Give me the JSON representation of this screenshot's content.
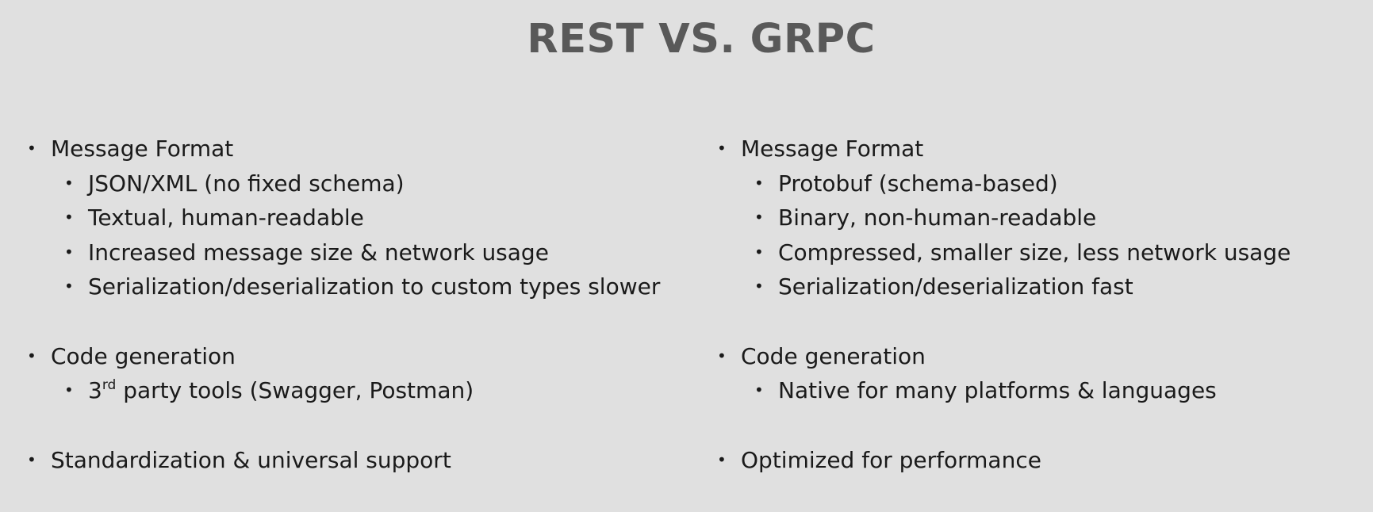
{
  "title": "REST VS. GRPC",
  "bullet_glyph": "•",
  "left": {
    "message_format": {
      "heading": "Message Format",
      "items": [
        "JSON/XML (no fixed schema)",
        "Textual, human-readable",
        "Increased message size & network usage",
        "Serialization/deserialization to custom types slower"
      ]
    },
    "code_generation": {
      "heading": "Code generation",
      "item_prefix": "3",
      "item_sup": "rd",
      "item_rest": " party tools (Swagger, Postman)"
    },
    "standardization": {
      "heading": "Standardization & universal support"
    }
  },
  "right": {
    "message_format": {
      "heading": "Message Format",
      "items": [
        "Protobuf (schema-based)",
        "Binary, non-human-readable",
        "Compressed, smaller size, less network usage",
        "Serialization/deserialization fast"
      ]
    },
    "code_generation": {
      "heading": "Code generation",
      "items": [
        "Native for many platforms & languages"
      ]
    },
    "performance": {
      "heading": "Optimized for performance"
    }
  }
}
